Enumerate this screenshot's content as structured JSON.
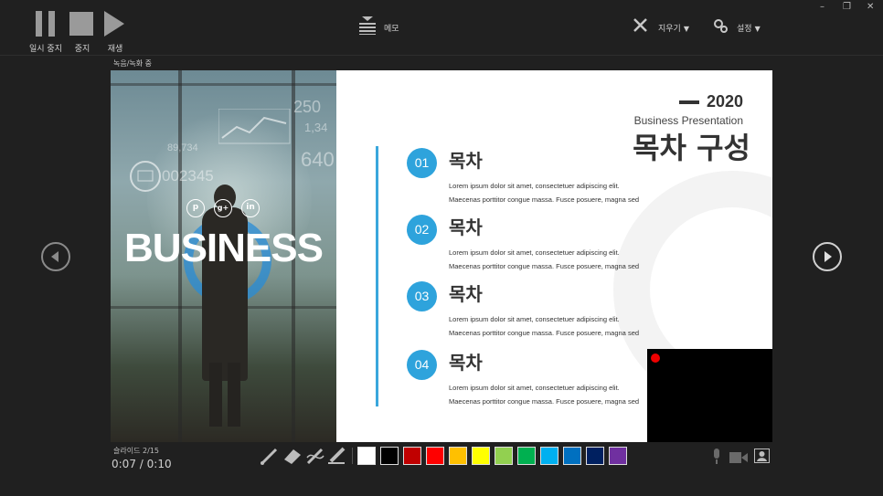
{
  "toolbar": {
    "pause_label": "일시 중지",
    "stop_label": "중지",
    "play_label": "재생",
    "memo_label": "메모",
    "erase_label": "지우기",
    "settings_label": "설정"
  },
  "window": {
    "minimize": "–",
    "restore": "❐",
    "close": "✕"
  },
  "status": {
    "recording_label": "녹음/녹화 중"
  },
  "slide": {
    "year": "2020",
    "subtitle": "Business Presentation",
    "title": "목차 구성",
    "photo_text": "BUSINESS",
    "social": [
      "p",
      "g+",
      "in"
    ],
    "deco_numbers": [
      "250",
      "1,34",
      "640",
      "002345",
      "89,734"
    ],
    "items": [
      {
        "number": "01",
        "title": "목차",
        "line1": "Lorem ipsum dolor sit amet, consectetuer adipiscing elit.",
        "line2": "Maecenas porttitor congue massa. Fusce posuere, magna sed"
      },
      {
        "number": "02",
        "title": "목차",
        "line1": "Lorem ipsum dolor sit amet, consectetuer adipiscing elit.",
        "line2": "Maecenas porttitor congue massa. Fusce posuere, magna sed"
      },
      {
        "number": "03",
        "title": "목차",
        "line1": "Lorem ipsum dolor sit amet, consectetuer adipiscing elit.",
        "line2": "Maecenas porttitor congue massa. Fusce posuere, magna sed"
      },
      {
        "number": "04",
        "title": "목차",
        "line1": "Lorem ipsum dolor sit amet, consectetuer adipiscing elit.",
        "line2": "Maecenas porttitor congue massa. Fusce posuere, magna sed"
      }
    ]
  },
  "footer": {
    "slide_counter": "슬라이드 2/15",
    "elapsed": "0:07",
    "timer_sep": "/",
    "total": "0:10"
  },
  "colors": {
    "accent": "#2ea3dc",
    "recording_dot": "#ee0000",
    "swatches": [
      "#ffffff",
      "#000000",
      "#c00000",
      "#ff0000",
      "#ffc000",
      "#ffff00",
      "#92d050",
      "#00b050",
      "#00b0f0",
      "#0070c0",
      "#002060",
      "#7030a0"
    ]
  },
  "icons": {
    "pen_tools": [
      "pen-icon",
      "eraser-icon",
      "laser-pointer-icon",
      "highlighter-icon"
    ],
    "media": [
      "microphone-icon",
      "camera-icon",
      "camera-preview-icon"
    ]
  }
}
